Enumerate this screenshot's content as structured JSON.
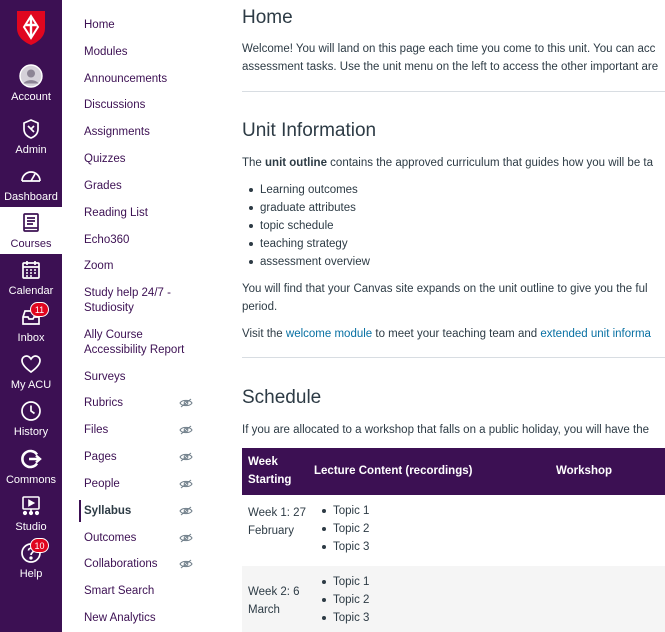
{
  "global_nav": {
    "items": [
      {
        "label": "Account",
        "icon": "account-icon"
      },
      {
        "label": "Admin",
        "icon": "admin-shield-icon"
      },
      {
        "label": "Dashboard",
        "icon": "dashboard-icon"
      },
      {
        "label": "Courses",
        "icon": "courses-book-icon"
      },
      {
        "label": "Calendar",
        "icon": "calendar-icon"
      },
      {
        "label": "Inbox",
        "icon": "inbox-icon",
        "badge": "11"
      },
      {
        "label": "My ACU",
        "icon": "heart-icon"
      },
      {
        "label": "History",
        "icon": "history-clock-icon"
      },
      {
        "label": "Commons",
        "icon": "commons-icon"
      },
      {
        "label": "Studio",
        "icon": "studio-icon"
      },
      {
        "label": "Help",
        "icon": "help-icon",
        "badge": "10"
      }
    ],
    "active": "Courses",
    "colors": {
      "brand": "#3c1053",
      "badge": "#e0061f",
      "logo": "#e0061f"
    }
  },
  "course_nav": {
    "items": [
      "Home",
      "Modules",
      "Announcements",
      "Discussions",
      "Assignments",
      "Quizzes",
      "Grades",
      "Reading List",
      "Echo360",
      "Zoom",
      "Study help 24/7 - Studiosity",
      "Ally Course Accessibility Report",
      "Surveys",
      "Rubrics",
      "Files",
      "Pages",
      "People",
      "Syllabus",
      "Outcomes",
      "Collaborations",
      "Smart Search",
      "New Analytics"
    ],
    "hidden_items": [
      "Rubrics",
      "Files",
      "Pages",
      "People",
      "Syllabus",
      "Outcomes",
      "Collaborations"
    ],
    "active": "Syllabus"
  },
  "content": {
    "home_heading": "Home",
    "welcome_line1": "Welcome! You will land on this page each time you come to this unit. You can acc",
    "welcome_line2": "assessment tasks. Use the unit menu on the left to access the other important are",
    "unit_info_heading": "Unit Information",
    "outline_pre": "The ",
    "outline_bold": "unit outline",
    "outline_post": " contains the approved curriculum that guides how you will be ta",
    "outline_items": [
      "Learning outcomes",
      "graduate attributes",
      "topic schedule",
      "teaching strategy",
      "assessment overview"
    ],
    "expands_line1": "You will find that your Canvas site expands on the unit outline to give you the ful",
    "expands_line2": "period.",
    "visit_pre": "Visit the ",
    "visit_link1": "welcome module",
    "visit_mid": " to meet your teaching team and ",
    "visit_link2": "extended unit informa",
    "schedule_heading": "Schedule",
    "schedule_intro": "If you are allocated to a workshop that falls on a public holiday, you will have the",
    "table": {
      "headers": [
        "Week Starting",
        "Lecture Content (recordings)",
        "Workshop"
      ],
      "rows": [
        {
          "week": "Week 1: 27 February",
          "topics": [
            "Topic 1",
            "Topic 2",
            "Topic 3"
          ]
        },
        {
          "week": "Week 2: 6 March",
          "topics": [
            "Topic 1",
            "Topic 2",
            "Topic 3"
          ]
        }
      ]
    },
    "colors": {
      "link": "#0770a3",
      "header_bg": "#3c1053"
    }
  }
}
